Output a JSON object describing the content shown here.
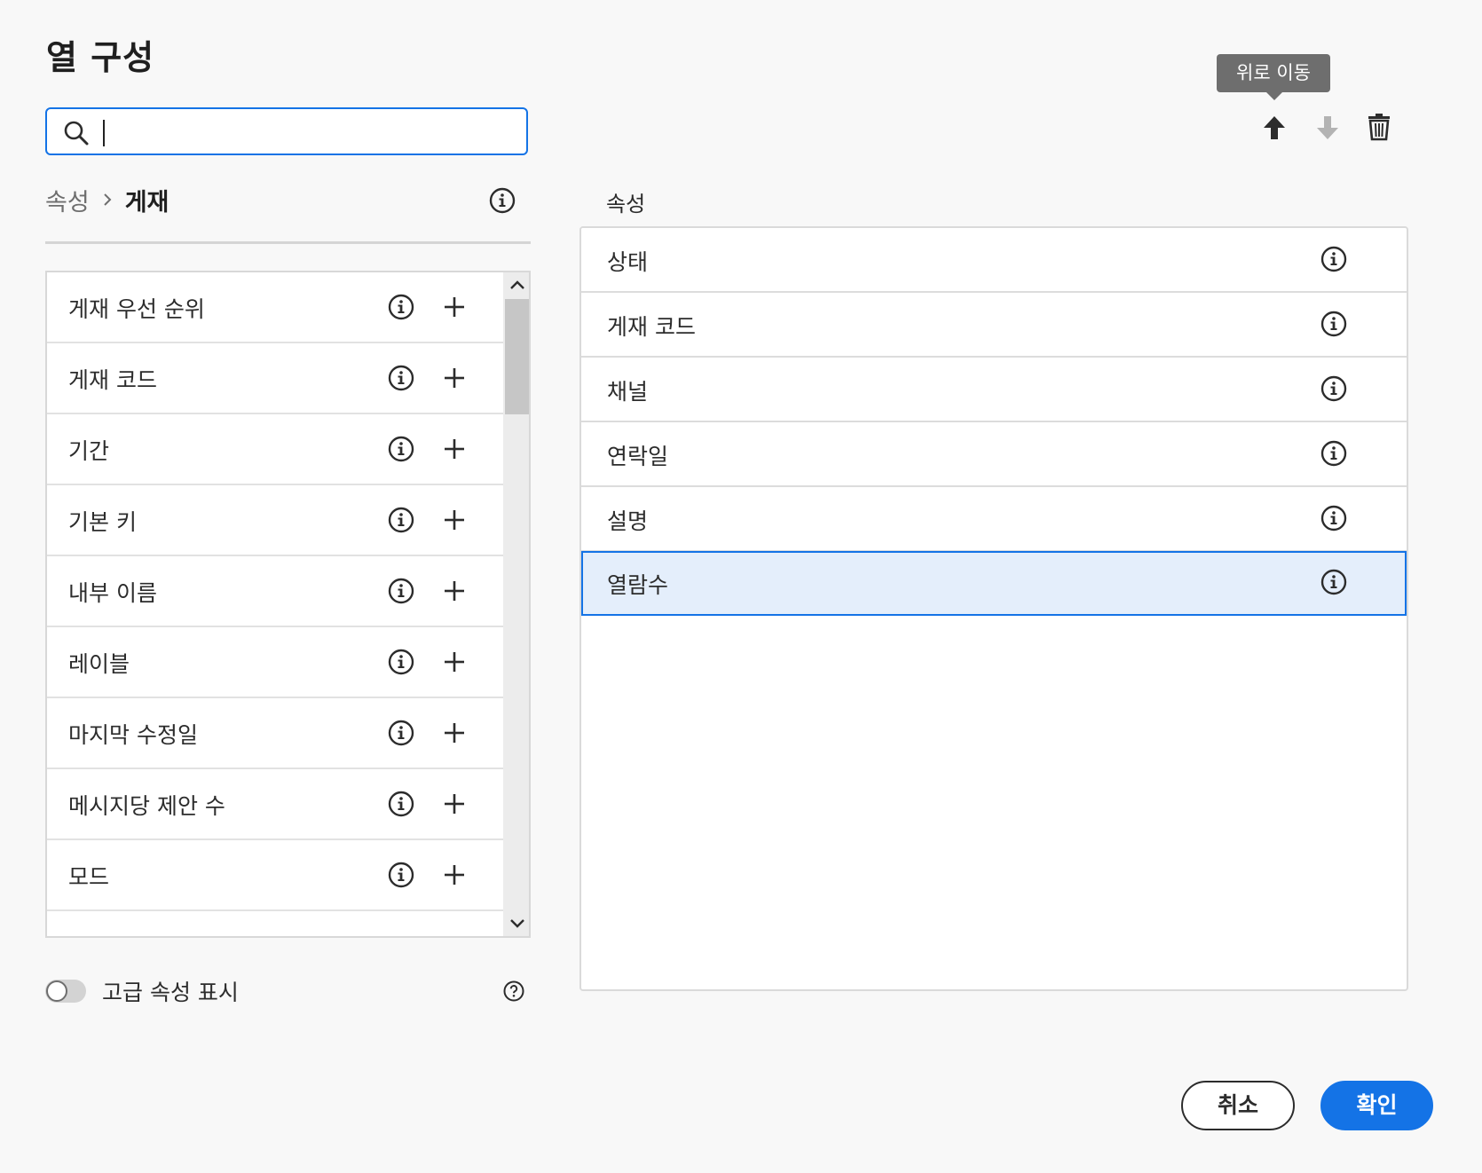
{
  "dialog": {
    "title": "열 구성"
  },
  "search": {
    "value": "",
    "placeholder": ""
  },
  "breadcrumb": {
    "root": "속성",
    "separator": "›",
    "current": "게재"
  },
  "available_fields": [
    {
      "label": "게재 우선 순위"
    },
    {
      "label": "게재 코드"
    },
    {
      "label": "기간"
    },
    {
      "label": "기본 키"
    },
    {
      "label": "내부 이름"
    },
    {
      "label": "레이블"
    },
    {
      "label": "마지막 수정일"
    },
    {
      "label": "메시지당 제안 수"
    },
    {
      "label": "모드"
    }
  ],
  "advanced_toggle": {
    "label": "고급 속성 표시",
    "on": false
  },
  "toolbar": {
    "tooltip": "위로 이동"
  },
  "selected_columns": {
    "heading": "속성",
    "items": [
      {
        "label": "상태"
      },
      {
        "label": "게재 코드"
      },
      {
        "label": "채널"
      },
      {
        "label": "연락일"
      },
      {
        "label": "설명"
      },
      {
        "label": "열람수",
        "selected": true
      }
    ]
  },
  "footer": {
    "cancel_label": "취소",
    "confirm_label": "확인"
  },
  "colors": {
    "accent": "#1473e6",
    "selected_row_bg": "#e4eefb",
    "tooltip_bg": "#6e6e6e"
  }
}
